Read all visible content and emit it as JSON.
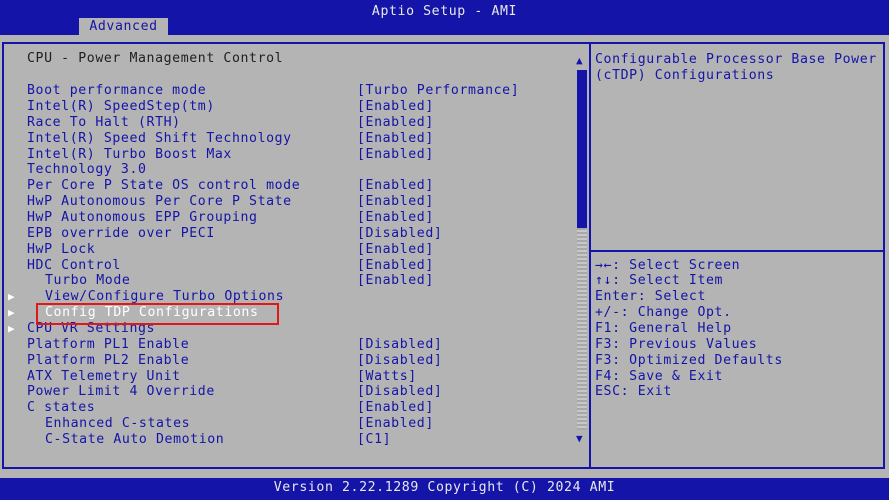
{
  "app": {
    "title": "Aptio Setup - AMI",
    "active_tab": "Advanced"
  },
  "section_title": "CPU - Power Management Control",
  "items": [
    {
      "label": "Boot performance mode",
      "value": "[Turbo Performance]"
    },
    {
      "label": "Intel(R) SpeedStep(tm)",
      "value": "[Enabled]"
    },
    {
      "label": "Race To Halt (RTH)",
      "value": "[Enabled]"
    },
    {
      "label": "Intel(R) Speed Shift Technology",
      "value": "[Enabled]"
    },
    {
      "label": "Intel(R) Turbo Boost Max",
      "value": "[Enabled]"
    },
    {
      "label": "Technology 3.0",
      "value": ""
    },
    {
      "label": "Per Core P State OS control mode",
      "value": "[Enabled]"
    },
    {
      "label": "HwP Autonomous Per Core P State",
      "value": "[Enabled]"
    },
    {
      "label": "HwP Autonomous EPP Grouping",
      "value": "[Enabled]"
    },
    {
      "label": "EPB override over PECI",
      "value": "[Disabled]"
    },
    {
      "label": "HwP Lock",
      "value": "[Enabled]"
    },
    {
      "label": "HDC Control",
      "value": "[Enabled]"
    },
    {
      "label": "Turbo Mode",
      "value": "[Enabled]"
    },
    {
      "label": "View/Configure Turbo Options",
      "value": ""
    },
    {
      "label": "Config TDP Configurations",
      "value": ""
    },
    {
      "label": "CPU VR Settings",
      "value": ""
    },
    {
      "label": "Platform PL1 Enable",
      "value": "[Disabled]"
    },
    {
      "label": "Platform PL2 Enable",
      "value": "[Disabled]"
    },
    {
      "label": "ATX Telemetry Unit",
      "value": "[Watts]"
    },
    {
      "label": "Power Limit 4 Override",
      "value": "[Disabled]"
    },
    {
      "label": "C states",
      "value": "[Enabled]"
    },
    {
      "label": "Enhanced C-states",
      "value": "[Enabled]"
    },
    {
      "label": "C-State Auto Demotion",
      "value": "[C1]"
    }
  ],
  "help_text": "Configurable Processor Base Power (cTDP) Configurations",
  "key_help": [
    "→←: Select Screen",
    "↑↓: Select Item",
    "Enter: Select",
    "+/-: Change Opt.",
    "F1: General Help",
    "F3: Previous Values",
    "F3: Optimized Defaults",
    "F4: Save & Exit",
    "ESC: Exit"
  ],
  "footer": "Version 2.22.1289 Copyright (C) 2024 AMI",
  "colors": {
    "blue": "#1414a8",
    "gray": "#b4b4b4",
    "highlight": "#e01818",
    "white": "#ffffff"
  }
}
